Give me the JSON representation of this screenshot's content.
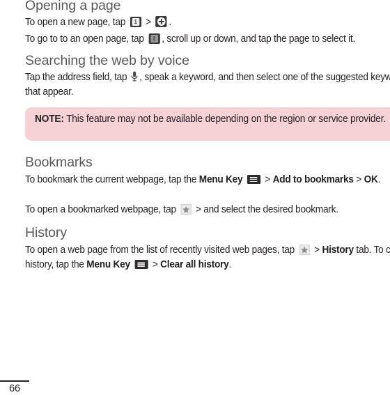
{
  "page": {
    "number": "66"
  },
  "sections": {
    "opening": {
      "heading": "Opening a page",
      "line1_a": "To open a new page, tap",
      "line1_sep": ">",
      "line1_b": ".",
      "line2_a": "To go to to an open page, tap",
      "line2_b": ", scroll up or down, and tap the page to select it."
    },
    "searching": {
      "heading": "Searching the web by voice",
      "line1_a": "Tap the address field, tap",
      "line1_b": ", speak a keyword, and then select one of the suggested keywords that appear."
    },
    "note": {
      "label": "NOTE:",
      "text": "This feature may not be available depending on the region or service provider.",
      "bg_color": "#f6d2d6"
    },
    "bookmarks": {
      "heading": "Bookmarks",
      "line1_a": "To bookmark the current webpage, tap the",
      "line1_menu_key": "Menu Key",
      "line1_sep1": ">",
      "line1_bold1": "Add to bookmarks",
      "line1_sep2": ">",
      "line1_bold2": "OK",
      "line1_end": ".",
      "line2_a": "To open a bookmarked webpage, tap",
      "line2_sep": ">",
      "line2_b": "and select the desired bookmark."
    },
    "history": {
      "heading": "History",
      "line1_a": "To open a web page from the list of recently visited web pages, tap",
      "line1_sep": ">",
      "line1_bold": "History",
      "line1_b": "tab. To clear the history, tap the",
      "line1_menu_key": "Menu Key",
      "line1_sep2": ">",
      "line1_bold2": "Clear all history",
      "line1_end": "."
    }
  },
  "icons": {
    "tab_count_one": "1",
    "tab_count_two": "2",
    "new_page": "new-page-icon",
    "microphone": "microphone-icon",
    "menu_key": "menu-key-icon",
    "bookmark_star": "star-icon"
  },
  "colors": {
    "heading": "#58585a",
    "body": "#231f20",
    "note_bg": "#f6d2d6",
    "icon_dark": "#3b3b3e"
  }
}
